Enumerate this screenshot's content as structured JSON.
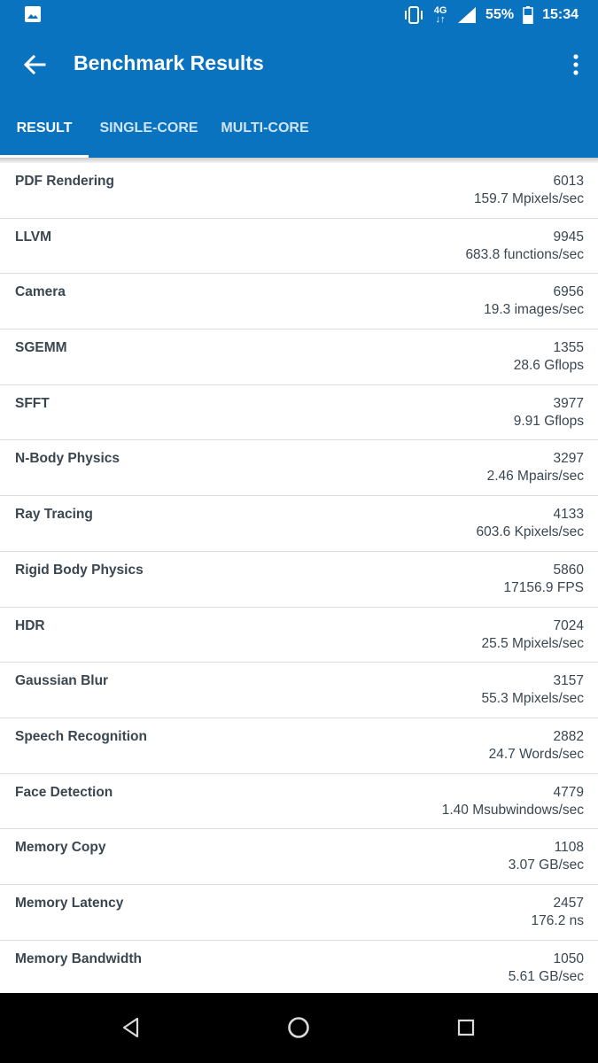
{
  "status_bar": {
    "network_label": "4G",
    "battery": "55%",
    "time": "15:34",
    "icons": [
      "image-icon",
      "vibrate-icon",
      "signal-icon",
      "battery-icon"
    ]
  },
  "toolbar": {
    "title": "Benchmark Results",
    "icons": [
      "back-arrow-icon",
      "more-vert-icon"
    ]
  },
  "tabs": [
    {
      "label": "RESULT",
      "active": true
    },
    {
      "label": "SINGLE-CORE",
      "active": false
    },
    {
      "label": "MULTI-CORE",
      "active": false
    }
  ],
  "results": [
    {
      "name": "PDF Rendering",
      "score": "6013",
      "rate": "159.7 Mpixels/sec"
    },
    {
      "name": "LLVM",
      "score": "9945",
      "rate": "683.8 functions/sec"
    },
    {
      "name": "Camera",
      "score": "6956",
      "rate": "19.3 images/sec"
    },
    {
      "name": "SGEMM",
      "score": "1355",
      "rate": "28.6 Gflops"
    },
    {
      "name": "SFFT",
      "score": "3977",
      "rate": "9.91 Gflops"
    },
    {
      "name": "N-Body Physics",
      "score": "3297",
      "rate": "2.46 Mpairs/sec"
    },
    {
      "name": "Ray Tracing",
      "score": "4133",
      "rate": "603.6 Kpixels/sec"
    },
    {
      "name": "Rigid Body Physics",
      "score": "5860",
      "rate": "17156.9 FPS"
    },
    {
      "name": "HDR",
      "score": "7024",
      "rate": "25.5 Mpixels/sec"
    },
    {
      "name": "Gaussian Blur",
      "score": "3157",
      "rate": "55.3 Mpixels/sec"
    },
    {
      "name": "Speech Recognition",
      "score": "2882",
      "rate": "24.7 Words/sec"
    },
    {
      "name": "Face Detection",
      "score": "4779",
      "rate": "1.40 Msubwindows/sec"
    },
    {
      "name": "Memory Copy",
      "score": "1108",
      "rate": "3.07 GB/sec"
    },
    {
      "name": "Memory Latency",
      "score": "2457",
      "rate": "176.2 ns"
    },
    {
      "name": "Memory Bandwidth",
      "score": "1050",
      "rate": "5.61 GB/sec"
    }
  ],
  "nav_bar": {
    "icons": [
      "back-triangle-icon",
      "home-circle-icon",
      "recents-square-icon"
    ]
  },
  "colors": {
    "primary": "#0a73bf",
    "text": "#3a4650",
    "divider": "#dcdcdc"
  }
}
